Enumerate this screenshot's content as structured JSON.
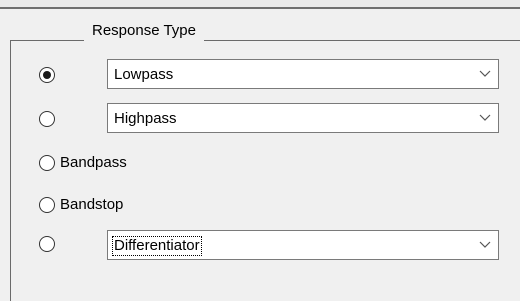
{
  "group": {
    "title": "Response Type"
  },
  "options": [
    {
      "id": "lowpass",
      "selected": true,
      "combo_value": "Lowpass"
    },
    {
      "id": "highpass",
      "selected": false,
      "combo_value": "Highpass"
    },
    {
      "id": "bandpass",
      "selected": false,
      "label": "Bandpass"
    },
    {
      "id": "bandstop",
      "selected": false,
      "label": "Bandstop"
    },
    {
      "id": "differentiator",
      "selected": false,
      "combo_value": "Differentiator"
    }
  ],
  "icons": {
    "dropdown": "chevron-down-icon"
  }
}
